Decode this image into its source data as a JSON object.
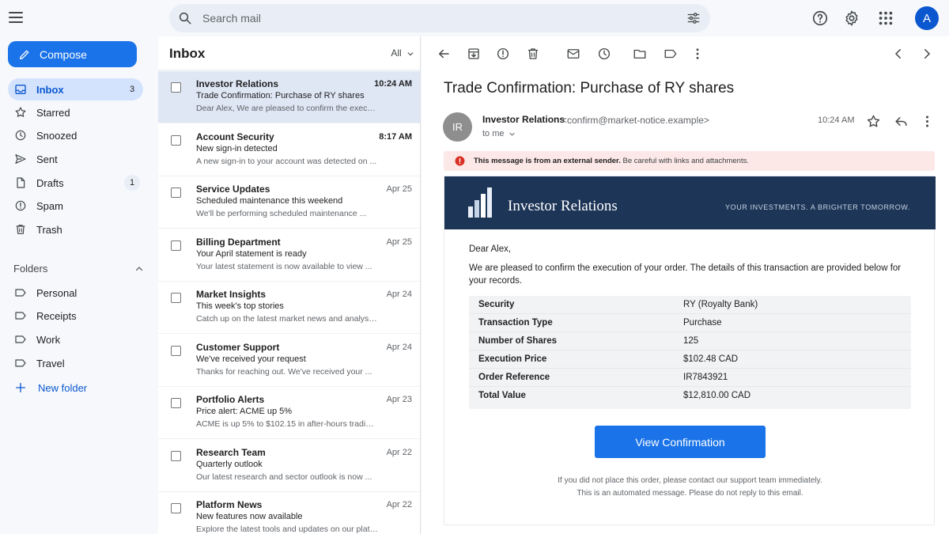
{
  "search": {
    "placeholder": "Search mail"
  },
  "user": {
    "initial": "A"
  },
  "sidebar": {
    "compose_label": "Compose",
    "items": [
      {
        "label": "Inbox",
        "count": "3",
        "icon": "inbox-icon"
      },
      {
        "label": "Starred",
        "count": "",
        "icon": "star-icon"
      },
      {
        "label": "Snoozed",
        "count": "",
        "icon": "clock-icon"
      },
      {
        "label": "Sent",
        "count": "",
        "icon": "send-icon"
      },
      {
        "label": "Drafts",
        "count": "1",
        "icon": "draft-icon"
      },
      {
        "label": "Spam",
        "count": "",
        "icon": "spam-icon"
      },
      {
        "label": "Trash",
        "count": "",
        "icon": "trash-icon"
      }
    ],
    "folders_heading": "Folders",
    "folders": [
      {
        "label": "Personal",
        "icon": "label-icon"
      },
      {
        "label": "Receipts",
        "icon": "label-icon"
      },
      {
        "label": "Work",
        "icon": "label-icon"
      },
      {
        "label": "Travel",
        "icon": "label-icon"
      }
    ],
    "new_folder_label": "New folder"
  },
  "list": {
    "title": "Inbox",
    "filter": "All",
    "emails": [
      {
        "sender": "Investor Relations",
        "date": "10:24 AM",
        "subject": "Trade Confirmation: Purchase of RY shares",
        "snippet": "Dear Alex, We are pleased to confirm the executi...",
        "selected": true,
        "bold_date": true
      },
      {
        "sender": "Account Security",
        "date": "8:17 AM",
        "subject": "New sign-in detected",
        "snippet": "A new sign-in to your account was detected on ...",
        "selected": false,
        "bold_date": true
      },
      {
        "sender": "Service Updates",
        "date": "Apr 25",
        "subject": "Scheduled maintenance this weekend",
        "snippet": "We'll be performing scheduled maintenance ...",
        "selected": false,
        "bold_date": false
      },
      {
        "sender": "Billing Department",
        "date": "Apr 25",
        "subject": "Your April statement is ready",
        "snippet": "Your latest statement is now available to view ...",
        "selected": false,
        "bold_date": false
      },
      {
        "sender": "Market Insights",
        "date": "Apr 24",
        "subject": "This week's top stories",
        "snippet": "Catch up on the latest market news and analysis ...",
        "selected": false,
        "bold_date": false
      },
      {
        "sender": "Customer Support",
        "date": "Apr 24",
        "subject": "We've received your request",
        "snippet": "Thanks for reaching out. We've received your ...",
        "selected": false,
        "bold_date": false
      },
      {
        "sender": "Portfolio Alerts",
        "date": "Apr 23",
        "subject": "Price alert: ACME up 5%",
        "snippet": "ACME is up 5% to $102.15 in after-hours trading ...",
        "selected": false,
        "bold_date": false
      },
      {
        "sender": "Research Team",
        "date": "Apr 22",
        "subject": "Quarterly outlook",
        "snippet": "Our latest research and sector outlook is now ...",
        "selected": false,
        "bold_date": false
      },
      {
        "sender": "Platform News",
        "date": "Apr 22",
        "subject": "New features now available",
        "snippet": "Explore the latest tools and updates on our platform ...",
        "selected": false,
        "bold_date": false
      }
    ]
  },
  "message": {
    "subject": "Trade Confirmation: Purchase of RY shares",
    "avatar_initials": "IR",
    "from_name": "Investor Relations",
    "from_email": "<confirm@market-notice.example>",
    "to": "to me",
    "time": "10:24 AM",
    "warning_bold": "This message is from an external sender.",
    "warning_rest": " Be careful with links and attachments.",
    "banner_brand": "Investor Relations",
    "banner_tagline": "YOUR INVESTMENTS. A BRIGHTER TOMORROW.",
    "greeting": "Dear Alex,",
    "intro": "We are pleased to confirm the execution of your order. The details of this transaction are provided below for your records.",
    "details": [
      {
        "key": "Security",
        "value": "RY (Royalty Bank)"
      },
      {
        "key": "Transaction Type",
        "value": "Purchase"
      },
      {
        "key": "Number of Shares",
        "value": "125"
      },
      {
        "key": "Execution Price",
        "value": "$102.48 CAD"
      },
      {
        "key": "Order Reference",
        "value": "IR7843921"
      },
      {
        "key": "Total Value",
        "value": "$12,810.00 CAD"
      }
    ],
    "cta_label": "View Confirmation",
    "footer_line1": "If you did not place this order, please contact our support team immediately.",
    "footer_line2": "This is an automated message. Please do not reply to this email."
  },
  "colors": {
    "accent": "#1a73e8",
    "selected_nav": "#d3e3fd",
    "banner": "#1d3557",
    "warning_bg": "#fce8e6",
    "warning_icon": "#d93025"
  }
}
